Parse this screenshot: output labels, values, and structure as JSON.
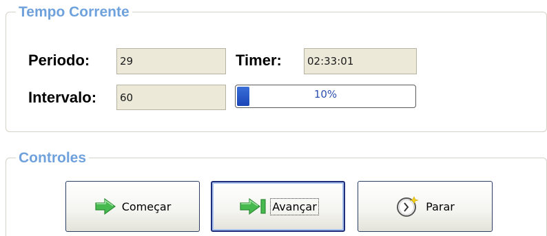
{
  "group_tempo": {
    "title": "Tempo Corrente",
    "periodo_label": "Periodo:",
    "periodo_value": "29",
    "timer_label": "Timer:",
    "timer_value": "02:33:01",
    "intervalo_label": "Intervalo:",
    "intervalo_value": "60",
    "progress": {
      "percent": 10,
      "text": "10%"
    }
  },
  "group_controles": {
    "title": "Controles",
    "buttons": {
      "start": {
        "label": "Começar",
        "icon": "green-arrow-right-icon"
      },
      "next": {
        "label": "Avançar",
        "icon": "green-arrow-skip-icon",
        "focused": true
      },
      "stop": {
        "label": "Parar",
        "icon": "clock-icon"
      }
    }
  },
  "colors": {
    "legend": "#6fa1dc",
    "progress_fill": "#1b46b8",
    "field_bg": "#ece9d8",
    "icon_green": "#3fb44a"
  }
}
